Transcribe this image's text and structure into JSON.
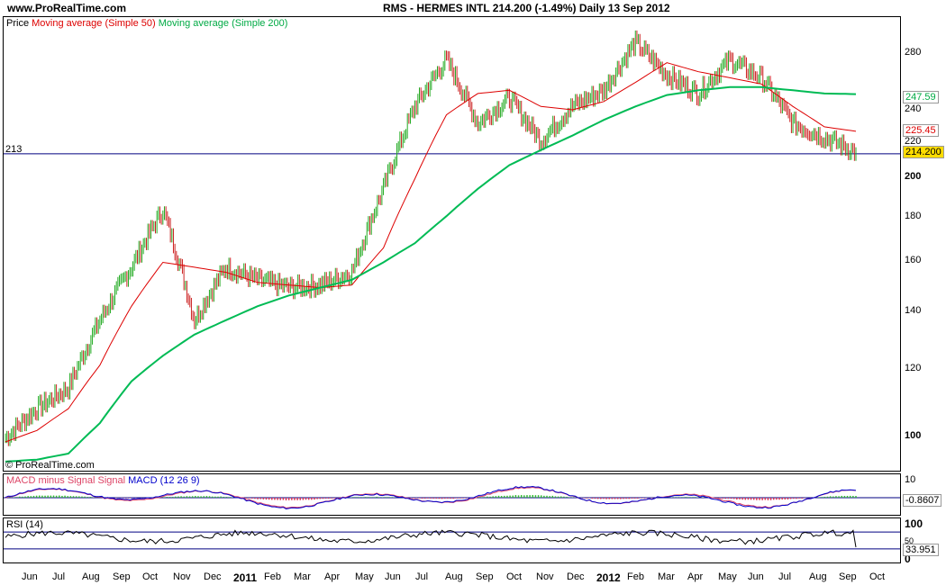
{
  "header": {
    "site": "www.ProRealTime.com",
    "title": "RMS - HERMES INTL    214.200 (-1.49%)    Daily  13 Sep 2012"
  },
  "watermark": "© ProRealTime.com",
  "price_panel": {
    "legend": [
      {
        "label": "Price",
        "color": "#000000"
      },
      {
        "label": "Moving average (Simple 50)",
        "color": "#dd0000"
      },
      {
        "label": "Moving average (Simple 200)",
        "color": "#00aa44"
      }
    ],
    "hline_label": "213",
    "y_ticks": [
      "280",
      "240",
      "220",
      "200",
      "180",
      "160",
      "140",
      "120",
      "100"
    ],
    "current_values": [
      {
        "label": "247.59",
        "color": "#00aa44"
      },
      {
        "label": "225.45",
        "color": "#dd0000"
      },
      {
        "label": "214.200",
        "color": "#000000",
        "bg": "#ffdd00"
      }
    ]
  },
  "macd_panel": {
    "legend": [
      {
        "label": "MACD minus Signal Signal",
        "color": "#dd4466"
      },
      {
        "label": "MACD (12 26 9)",
        "color": "#0000cc"
      }
    ],
    "y_ticks": [
      "10"
    ],
    "current_value": "-0.8607"
  },
  "rsi_panel": {
    "legend": [
      {
        "label": "RSI (14)",
        "color": "#000000"
      }
    ],
    "y_ticks": [
      "100",
      "50",
      "0"
    ],
    "current_value": "33.951"
  },
  "x_axis": {
    "months": [
      "Jun",
      "Jul",
      "Aug",
      "Sep",
      "Oct",
      "Nov",
      "Dec",
      "2011",
      "Feb",
      "Mar",
      "Apr",
      "May",
      "Jun",
      "Jul",
      "Aug",
      "Sep",
      "Oct",
      "Nov",
      "Dec",
      "2012",
      "Feb",
      "Mar",
      "Apr",
      "May",
      "Jun",
      "Jul",
      "Aug",
      "Sep",
      "Oct"
    ]
  },
  "chart_data": {
    "type": "line",
    "title": "RMS - HERMES INTL 214.200 (-1.49%) Daily 13 Sep 2012",
    "scale": "log",
    "ylim": [
      96,
      300
    ],
    "x": [
      "2010-06",
      "2010-07",
      "2010-08",
      "2010-09",
      "2010-10",
      "2010-11",
      "2010-12",
      "2011-01",
      "2011-02",
      "2011-03",
      "2011-04",
      "2011-05",
      "2011-06",
      "2011-07",
      "2011-08",
      "2011-09",
      "2011-10",
      "2011-11",
      "2011-12",
      "2012-01",
      "2012-02",
      "2012-03",
      "2012-04",
      "2012-05",
      "2012-06",
      "2012-07",
      "2012-08",
      "2012-09"
    ],
    "series": [
      {
        "name": "Price",
        "values": [
          104,
          112,
          118,
          140,
          160,
          185,
          140,
          160,
          155,
          152,
          153,
          158,
          195,
          240,
          270,
          230,
          245,
          220,
          240,
          250,
          282,
          260,
          248,
          270,
          258,
          230,
          222,
          214
        ]
      },
      {
        "name": "Moving average (Simple 50)",
        "values": [
          103,
          106,
          112,
          125,
          145,
          162,
          160,
          158,
          154,
          153,
          152,
          153,
          168,
          200,
          235,
          248,
          250,
          240,
          238,
          243,
          255,
          268,
          262,
          258,
          254,
          240,
          228,
          225.45
        ]
      },
      {
        "name": "Moving average (Simple 200)",
        "values": [
          98,
          98.5,
          100,
          108,
          120,
          128,
          135,
          140,
          145,
          149,
          152,
          155,
          162,
          170,
          182,
          195,
          207,
          215,
          223,
          232,
          240,
          247,
          250,
          252,
          252,
          250,
          248,
          247.59
        ]
      }
    ],
    "hline": 213,
    "macd": {
      "last": -0.8607
    },
    "rsi": {
      "last": 33.951
    }
  }
}
